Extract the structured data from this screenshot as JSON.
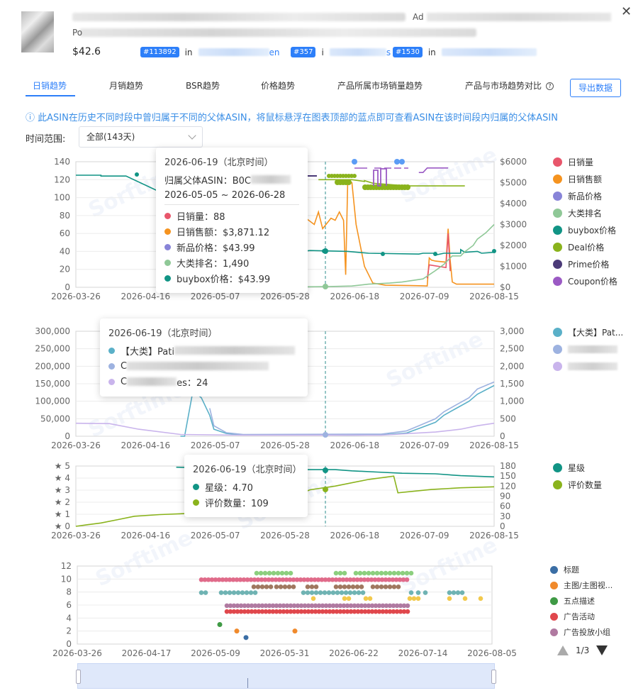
{
  "header": {
    "title_fragment_1": "Ad",
    "title_fragment_2": "Po",
    "price": "$42.6",
    "ranks": [
      {
        "badge": "#113892",
        "prep": "in",
        "cat_tail": "en"
      },
      {
        "badge": "#357",
        "prep": "i",
        "cat_tail": "s"
      },
      {
        "badge": "#1530",
        "prep": "in",
        "cat_tail": ""
      }
    ]
  },
  "tabs": [
    "日销趋势",
    "月销趋势",
    "BSR趋势",
    "价格趋势",
    "产品所属市场销量趋势",
    "产品与市场趋势对比"
  ],
  "active_tab": 0,
  "export_label": "导出数据",
  "notice": "ⓘ 此ASIN在历史不同时段中曾归属于不同的父体ASIN，将鼠标悬浮在图表顶部的蓝点即可查看ASIN在该时间段内归属的父体ASIN",
  "time_range": {
    "label": "时间范围:",
    "value": "全部(143天)"
  },
  "watermark": "Sorftime",
  "colors": {
    "blue": "#2d7ff9",
    "sales": "#e8566b",
    "revenue": "#f5931f",
    "new_price": "#8884d8",
    "rank": "#8fc897",
    "buybox": "#119485",
    "deal": "#8ab31c",
    "prime": "#4b3a78",
    "coupon": "#9b5ac4",
    "cat1": "#5ab0c8",
    "cat2": "#9db2e0",
    "cat3": "#c9b4ec",
    "star": "#119485",
    "reviews": "#8ab31c"
  },
  "chart_data": [
    {
      "type": "line",
      "title": "",
      "x_labels": [
        "2026-03-26",
        "2026-04-16",
        "2026-05-07",
        "2026-05-28",
        "2026-06-18",
        "2026-07-09",
        "2026-08-15"
      ],
      "ylim_left": [
        0,
        140
      ],
      "ylim_right": [
        0,
        6000
      ],
      "left_ticks": [
        "140",
        "120",
        "100",
        "80",
        "60",
        "40",
        "20",
        "0"
      ],
      "right_ticks": [
        "$6000",
        "$5000",
        "$4000",
        "$3000",
        "$2000",
        "$1000",
        "$0"
      ],
      "legend": [
        "日销量",
        "日销售额",
        "新品价格",
        "大类排名",
        "buybox价格",
        "Deal价格",
        "Prime价格",
        "Coupon价格"
      ],
      "series": [
        {
          "name": "日销售额",
          "axis": "right",
          "points": [
            [
              0.47,
              4150
            ],
            [
              0.5,
              4150
            ],
            [
              0.5,
              3400
            ],
            [
              0.52,
              3400
            ],
            [
              0.52,
              3700
            ],
            [
              0.55,
              3800
            ],
            [
              0.55,
              3300
            ],
            [
              0.57,
              3000
            ],
            [
              0.58,
              3600
            ],
            [
              0.59,
              2800
            ],
            [
              0.61,
              3300
            ],
            [
              0.62,
              3200
            ],
            [
              0.63,
              3600
            ],
            [
              0.64,
              3200
            ],
            [
              0.645,
              600
            ],
            [
              0.65,
              5100
            ],
            [
              0.66,
              5000
            ],
            [
              0.67,
              3000
            ],
            [
              0.68,
              2000
            ],
            [
              0.69,
              1000
            ],
            [
              0.7,
              600
            ],
            [
              0.71,
              200
            ],
            [
              0.74,
              100
            ],
            [
              0.8,
              80
            ],
            [
              0.83,
              70
            ],
            [
              0.84,
              60
            ],
            [
              0.845,
              1400
            ],
            [
              0.85,
              1300
            ],
            [
              0.86,
              1250
            ],
            [
              0.885,
              1200
            ],
            [
              0.89,
              2800
            ],
            [
              0.895,
              1300
            ],
            [
              0.9,
              250
            ],
            [
              0.91,
              150
            ],
            [
              1.0,
              150
            ]
          ]
        },
        {
          "name": "日销量",
          "axis": "left",
          "points": [
            [
              0.84,
              10
            ],
            [
              0.845,
              25
            ],
            [
              0.885,
              22
            ],
            [
              0.89,
              60
            ],
            [
              0.895,
              18
            ]
          ]
        },
        {
          "name": "buybox价格",
          "axis": "left",
          "points": [
            [
              0.0,
              125
            ],
            [
              0.06,
              125
            ],
            [
              0.06,
              124
            ],
            [
              0.12,
              124
            ],
            [
              0.5,
              41
            ],
            [
              0.5,
              41
            ],
            [
              0.54,
              41
            ],
            [
              0.54,
              40
            ],
            [
              0.56,
              41
            ],
            [
              0.65,
              40
            ],
            [
              0.7,
              38
            ],
            [
              0.82,
              37
            ],
            [
              0.83,
              38
            ],
            [
              0.83,
              38
            ],
            [
              0.86,
              38
            ],
            [
              0.86,
              36
            ],
            [
              0.88,
              38
            ],
            [
              0.92,
              38
            ],
            [
              0.92,
              42
            ],
            [
              0.93,
              39
            ],
            [
              0.96,
              40
            ],
            [
              0.97,
              38
            ],
            [
              1.0,
              39
            ]
          ]
        },
        {
          "name": "大类排名",
          "axis": "right",
          "points": [
            [
              0.5,
              10
            ],
            [
              0.6,
              30
            ],
            [
              0.66,
              60
            ],
            [
              0.7,
              150
            ],
            [
              0.75,
              200
            ],
            [
              0.78,
              250
            ],
            [
              0.83,
              400
            ],
            [
              0.86,
              800
            ],
            [
              0.88,
              1100
            ],
            [
              0.9,
              1500
            ],
            [
              0.92,
              1500
            ],
            [
              0.93,
              1700
            ],
            [
              0.95,
              2000
            ],
            [
              0.96,
              2300
            ],
            [
              0.98,
              2600
            ],
            [
              1.0,
              3000
            ]
          ]
        },
        {
          "name": "Deal价格",
          "axis": "left",
          "points": [
            [
              0.58,
              120
            ],
            [
              0.66,
              120
            ],
            [
              0.69,
              118
            ],
            [
              0.69,
              119
            ],
            [
              0.71,
              116
            ],
            [
              0.79,
              113
            ],
            [
              0.81,
              113
            ],
            [
              0.85,
              113
            ],
            [
              0.87,
              113
            ],
            [
              0.89,
              113
            ],
            [
              0.91,
              113
            ],
            [
              0.93,
              113
            ]
          ]
        },
        {
          "name": "Coupon价格",
          "axis": "left",
          "points": [
            [
              0.82,
              128
            ],
            [
              0.83,
              128
            ],
            [
              0.84,
              133
            ],
            [
              0.86,
              133
            ],
            [
              0.88,
              133
            ],
            [
              0.89,
              133
            ]
          ]
        }
      ],
      "annotations": []
    },
    {
      "type": "line",
      "title": "",
      "x_labels": [
        "2026-03-26",
        "2026-04-16",
        "2026-05-07",
        "2026-05-28",
        "2026-06-18",
        "2026-07-09",
        "2026-08-15"
      ],
      "left_ticks": [
        "300,000",
        "250,000",
        "200,000",
        "150,000",
        "100,000",
        "50,000",
        "0"
      ],
      "right_ticks": [
        "3,000",
        "2,500",
        "2,000",
        "1,500",
        "1,000",
        "500",
        "0"
      ],
      "ylim_left": [
        0,
        300000
      ],
      "ylim_right": [
        0,
        3000
      ],
      "legend": [
        "【大类】Pat..."
      ],
      "series": [
        {
          "name": "【大类】Pat...",
          "axis": "left",
          "points": [
            [
              0.25,
              0
            ],
            [
              0.26,
              0
            ],
            [
              0.28,
              130000
            ],
            [
              0.3,
              110000
            ],
            [
              0.32,
              60000
            ],
            [
              0.33,
              20000
            ],
            [
              0.36,
              8000
            ],
            [
              0.4,
              4000
            ],
            [
              0.55,
              4000
            ],
            [
              0.65,
              3000
            ],
            [
              0.73,
              4000
            ],
            [
              0.79,
              9000
            ],
            [
              0.82,
              22000
            ],
            [
              0.86,
              40000
            ],
            [
              0.88,
              60000
            ],
            [
              0.91,
              80000
            ],
            [
              0.94,
              100000
            ],
            [
              0.96,
              120000
            ],
            [
              1.0,
              145000
            ]
          ]
        },
        {
          "name": "series-2",
          "axis": "left",
          "points": [
            [
              0.32,
              80000
            ],
            [
              0.33,
              30000
            ],
            [
              0.36,
              10000
            ],
            [
              0.4,
              5000
            ],
            [
              0.73,
              6000
            ],
            [
              0.79,
              15000
            ],
            [
              0.82,
              30000
            ],
            [
              0.86,
              50000
            ],
            [
              0.88,
              70000
            ],
            [
              0.91,
              90000
            ],
            [
              0.94,
              110000
            ],
            [
              0.96,
              135000
            ],
            [
              1.0,
              155000
            ]
          ]
        },
        {
          "name": "series-3",
          "axis": "right",
          "points": [
            [
              0.0,
              370
            ],
            [
              0.08,
              360
            ],
            [
              0.15,
              200
            ],
            [
              0.25,
              50
            ],
            [
              0.4,
              30
            ],
            [
              0.6,
              30
            ],
            [
              0.73,
              30
            ],
            [
              0.8,
              80
            ],
            [
              0.86,
              120
            ],
            [
              0.92,
              200
            ],
            [
              0.96,
              300
            ],
            [
              1.0,
              370
            ]
          ]
        }
      ]
    },
    {
      "type": "line",
      "title": "",
      "x_labels": [
        "2026-03-26",
        "2026-04-16",
        "2026-05-07",
        "2026-05-28",
        "2026-06-18",
        "2026-07-09",
        "2026-08-15"
      ],
      "left_ticks": [
        "★ 5",
        "★ 4",
        "★ 3",
        "★ 2",
        "★ 1",
        "★ 0"
      ],
      "right_ticks": [
        "180",
        "150",
        "120",
        "90",
        "60",
        "30",
        "0"
      ],
      "ylim_left": [
        0,
        5
      ],
      "ylim_right": [
        0,
        180
      ],
      "legend": [
        "星级",
        "评价数量"
      ],
      "series": [
        {
          "name": "星级",
          "axis": "left",
          "points": [
            [
              0.24,
              4.9
            ],
            [
              0.5,
              4.7
            ],
            [
              0.62,
              4.7
            ],
            [
              0.66,
              4.6
            ],
            [
              0.72,
              4.5
            ],
            [
              0.78,
              4.4
            ],
            [
              0.86,
              4.35
            ],
            [
              0.92,
              4.2
            ],
            [
              1.0,
              4.1
            ]
          ]
        },
        {
          "name": "评价数量",
          "axis": "right",
          "points": [
            [
              0.0,
              0
            ],
            [
              0.03,
              5
            ],
            [
              0.06,
              10
            ],
            [
              0.1,
              20
            ],
            [
              0.14,
              30
            ],
            [
              0.2,
              35
            ],
            [
              0.3,
              40
            ],
            [
              0.4,
              60
            ],
            [
              0.5,
              80
            ],
            [
              0.56,
              109
            ],
            [
              0.62,
              120
            ],
            [
              0.7,
              140
            ],
            [
              0.76,
              150
            ],
            [
              0.77,
              100
            ],
            [
              0.85,
              110
            ],
            [
              0.92,
              115
            ],
            [
              1.0,
              118
            ]
          ]
        }
      ]
    },
    {
      "type": "scatter",
      "title": "",
      "x_labels": [
        "2026-03-26",
        "2026-04-17",
        "2026-05-09",
        "2026-05-31",
        "2026-06-22",
        "2026-07-14",
        "2026-08-05"
      ],
      "y_ticks": [
        "12",
        "10",
        "8",
        "6",
        "4",
        "2",
        "0"
      ],
      "ylim": [
        0,
        12
      ],
      "legend": [
        "标题",
        "主图/主图视...",
        "五点描述",
        "广告活动",
        "广告投放小组"
      ],
      "pager": "1/3"
    }
  ],
  "tooltips": [
    {
      "date": "2026-06-19（北京时间）",
      "parent_label": "归属父体ASIN：B0C",
      "period": "2026-05-05 ~ 2026-06-28",
      "rows": [
        "日销量：88",
        "日销售额：$3,871.12",
        "新品价格：$43.99",
        "大类排名：1,490",
        "buybox价格：$43.99"
      ]
    },
    {
      "date": "2026-06-19（北京时间）",
      "rows": [
        "【大类】Pati",
        "C",
        "C",
        "es：24"
      ]
    },
    {
      "date": "2026-06-19（北京时间）",
      "rows": [
        "星级：4.70",
        "评价数量：109"
      ]
    }
  ]
}
